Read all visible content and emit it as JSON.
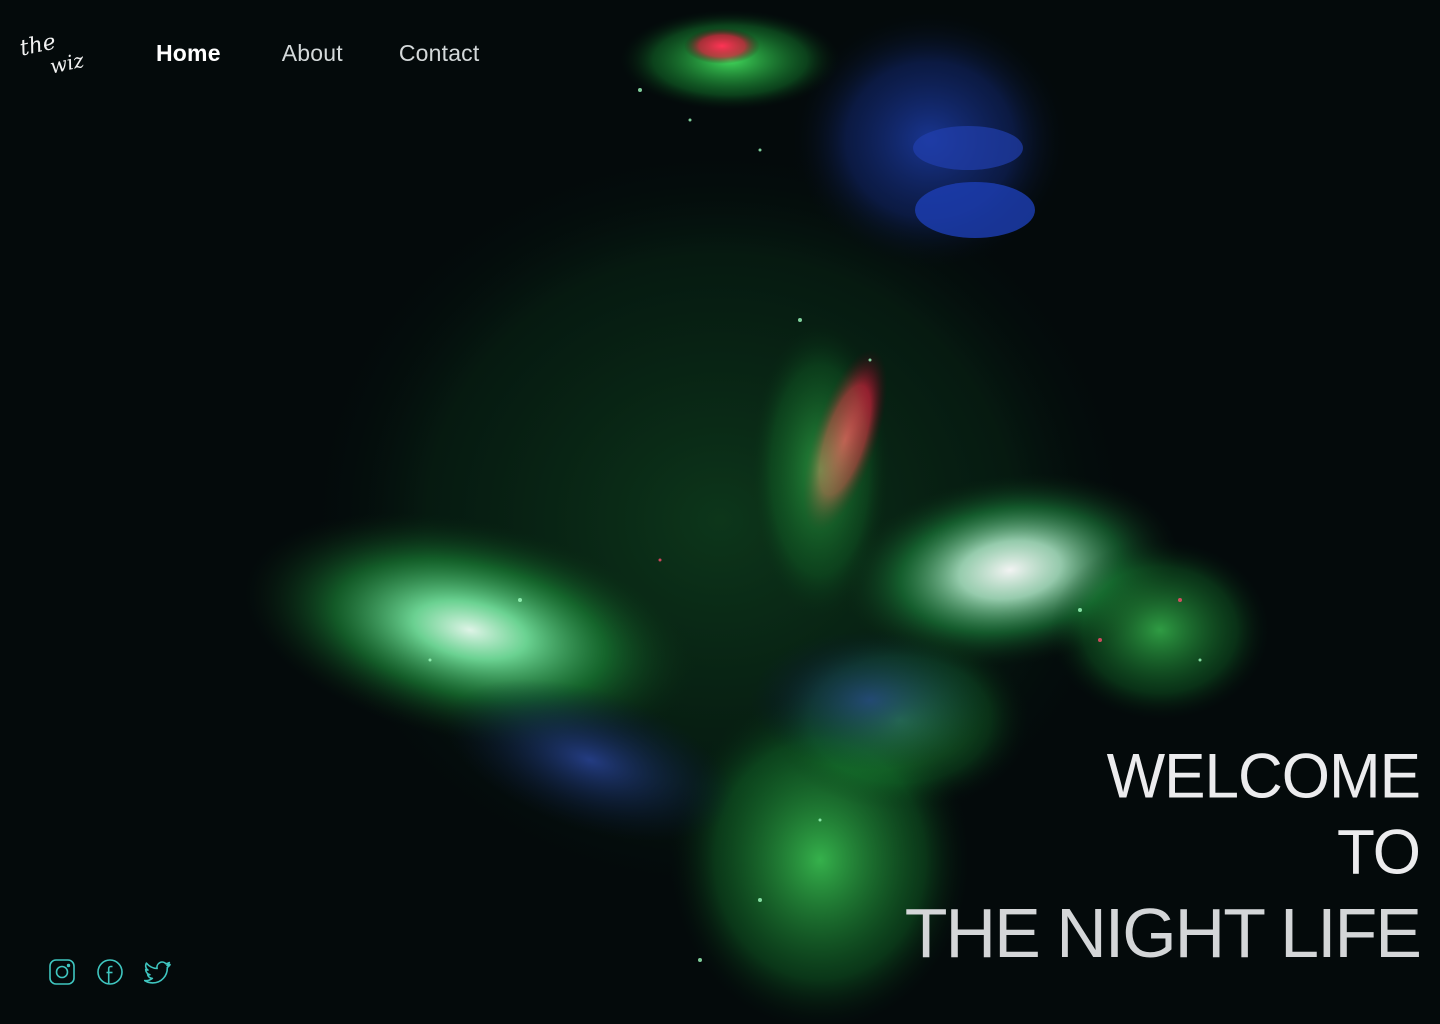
{
  "brand": {
    "logo_text_1": "the",
    "logo_text_2": "wiz"
  },
  "nav": {
    "items": [
      {
        "label": "Home",
        "active": true
      },
      {
        "label": "About",
        "active": false
      },
      {
        "label": "Contact",
        "active": false
      }
    ]
  },
  "hero": {
    "line1": "WELCOME",
    "line2": "TO",
    "line3": "THE NIGHT LIFE"
  },
  "social": {
    "icons": [
      "instagram-icon",
      "facebook-icon",
      "twitter-icon"
    ],
    "icon_color": "#3fc6c0"
  },
  "colors": {
    "background": "#040a0b",
    "neon_green": "#3ee05a",
    "neon_red": "#ff2d55",
    "uv_blue": "#1c3fa8"
  }
}
